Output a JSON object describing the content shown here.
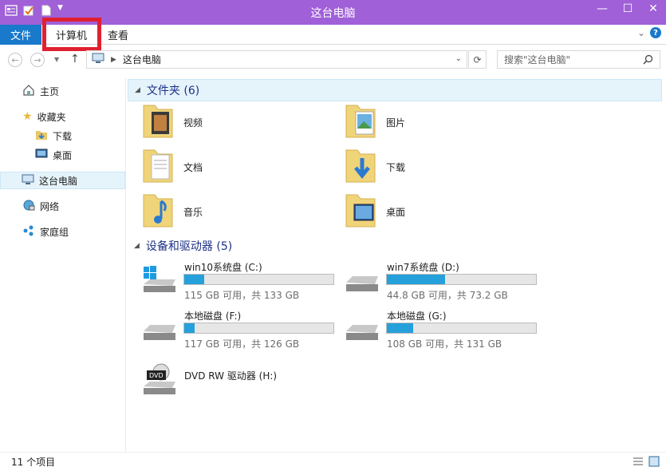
{
  "window": {
    "title": "这台电脑",
    "controls": {
      "minimize": "—",
      "maximize": "☐",
      "close": "✕"
    },
    "accent": "#a060d8"
  },
  "ribbon": {
    "tabs": [
      {
        "label": "文件",
        "active": true
      },
      {
        "label": "计算机",
        "highlighted": true
      },
      {
        "label": "查看"
      }
    ],
    "expand_icon": "chevron-down-icon",
    "help": "?"
  },
  "address": {
    "path": "这台电脑",
    "search_placeholder": "搜索\"这台电脑\""
  },
  "nav": {
    "items": [
      {
        "label": "主页",
        "icon": "home-icon"
      },
      {
        "label": "收藏夹",
        "icon": "star-icon"
      },
      {
        "label": "下载",
        "icon": "downloads-folder-icon"
      },
      {
        "label": "桌面",
        "icon": "desktop-icon"
      },
      {
        "label": "这台电脑",
        "icon": "computer-icon",
        "selected": true
      },
      {
        "label": "网络",
        "icon": "network-icon"
      },
      {
        "label": "家庭组",
        "icon": "homegroup-icon"
      }
    ]
  },
  "folders_group": {
    "title": "文件夹 (6)",
    "items": [
      {
        "label": "视频"
      },
      {
        "label": "图片"
      },
      {
        "label": "文档"
      },
      {
        "label": "下载"
      },
      {
        "label": "音乐"
      },
      {
        "label": "桌面"
      }
    ]
  },
  "devices_group": {
    "title": "设备和驱动器 (5)",
    "drives": [
      {
        "name": "win10系统盘 (C:)",
        "space": "115 GB 可用，共 133 GB",
        "used_fraction": 0.135
      },
      {
        "name": "win7系统盘 (D:)",
        "space": "44.8 GB 可用，共 73.2 GB",
        "used_fraction": 0.388
      },
      {
        "name": "本地磁盘 (F:)",
        "space": "117 GB 可用，共 126 GB",
        "used_fraction": 0.071
      },
      {
        "name": "本地磁盘 (G:)",
        "space": "108 GB 可用，共 131 GB",
        "used_fraction": 0.176
      },
      {
        "name": "DVD RW 驱动器 (H:)"
      }
    ]
  },
  "status": {
    "count": "11 个项目"
  }
}
